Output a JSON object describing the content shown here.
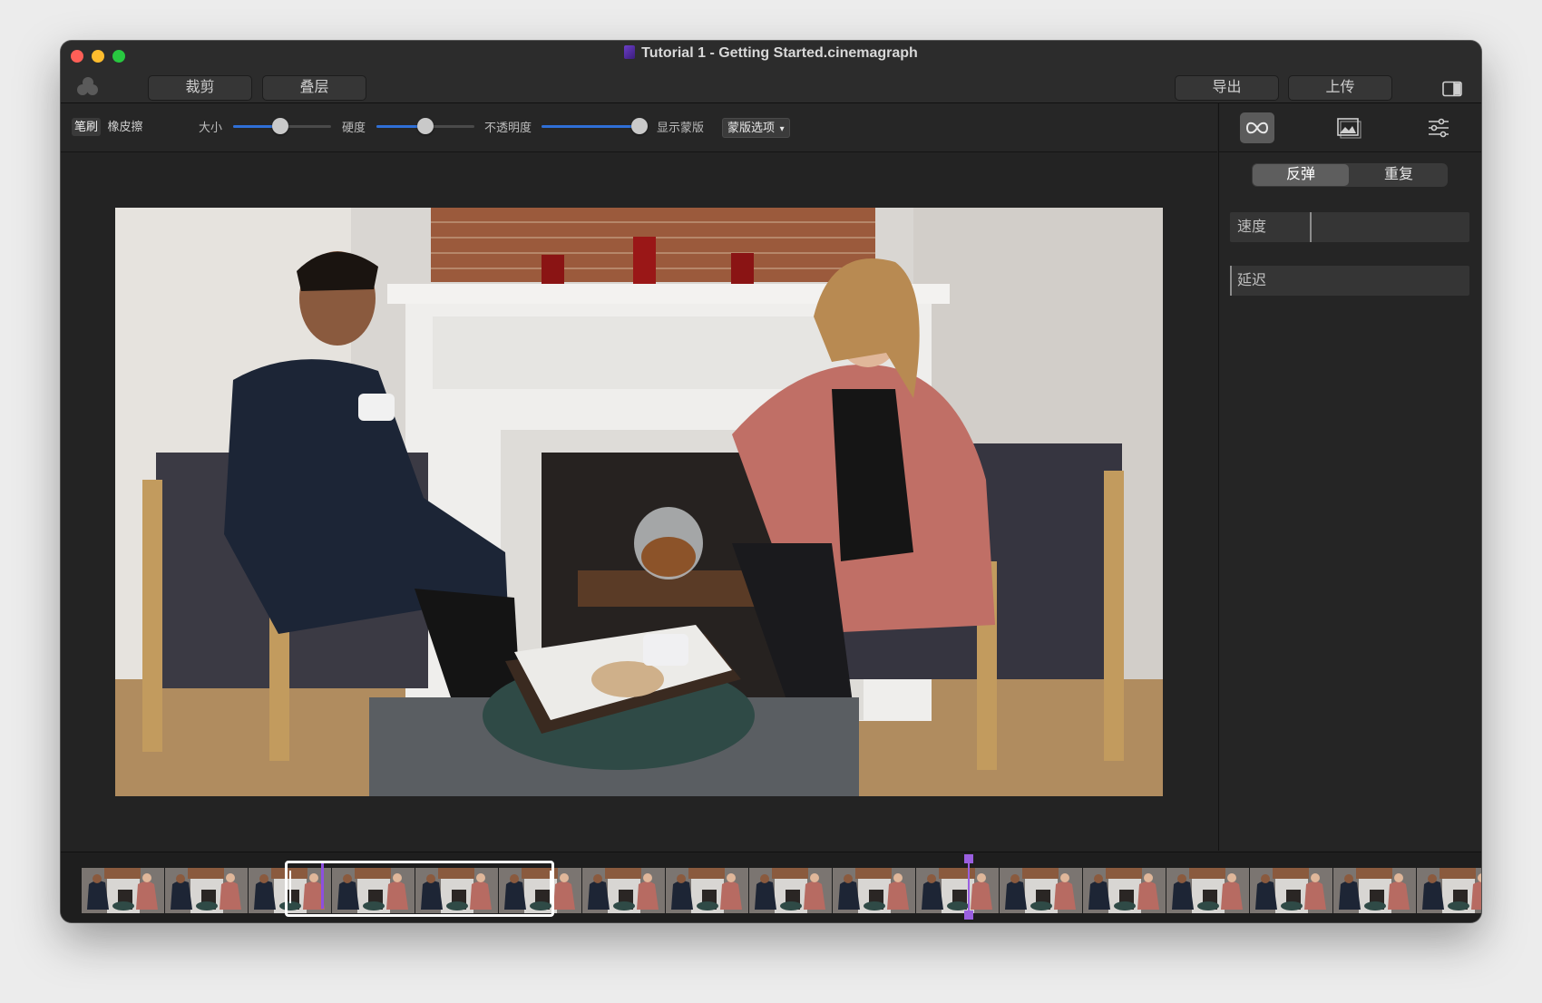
{
  "window": {
    "title": "Tutorial 1 - Getting Started.cinemagraph"
  },
  "toolbar": {
    "crop_label": "裁剪",
    "layers_label": "叠层",
    "export_label": "导出",
    "upload_label": "上传"
  },
  "brush_bar": {
    "brush_label": "笔刷",
    "eraser_label": "橡皮擦",
    "size_label": "大小",
    "size_value": 0.48,
    "hardness_label": "硬度",
    "hardness_value": 0.5,
    "opacity_label": "不透明度",
    "opacity_value": 0.98,
    "show_mask_label": "显示蒙版",
    "mask_options_label": "蒙版选项"
  },
  "right_panel": {
    "icons": [
      "loop-icon",
      "image-icon",
      "sliders-icon"
    ],
    "bounce_label": "反弹",
    "repeat_label": "重复",
    "speed_label": "速度",
    "delay_label": "延迟"
  },
  "timeline": {
    "frame_count": 19,
    "selection": "frames 3–5",
    "playhead_color": "#9a5fe0"
  },
  "colors": {
    "accent": "#2f6fd6",
    "window_bg": "#232323",
    "panel_bg": "#252525"
  }
}
